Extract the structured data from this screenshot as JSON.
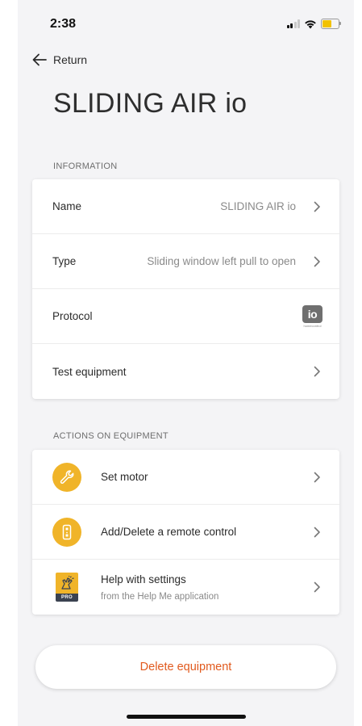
{
  "status_bar": {
    "time": "2:38"
  },
  "nav": {
    "return_label": "Return"
  },
  "page": {
    "title": "SLIDING AIR io"
  },
  "information": {
    "section_title": "INFORMATION",
    "rows": [
      {
        "label": "Name",
        "value": "SLIDING AIR io"
      },
      {
        "label": "Type",
        "value": "Sliding window left pull to open"
      },
      {
        "label": "Protocol",
        "value": "",
        "badge": "io",
        "badge_sub": "homecontrol"
      },
      {
        "label": "Test equipment",
        "value": ""
      }
    ]
  },
  "actions": {
    "section_title": "ACTIONS ON EQUIPMENT",
    "items": [
      {
        "label": "Set motor",
        "icon": "wrench-icon"
      },
      {
        "label": "Add/Delete a remote control",
        "icon": "remote-control-icon"
      },
      {
        "label": "Help with settings",
        "sublabel": "from the Help Me application",
        "icon": "help-me-pro-icon",
        "badge": "PRO"
      }
    ]
  },
  "footer": {
    "delete_label": "Delete equipment"
  },
  "colors": {
    "accent": "#f0b429",
    "danger": "#e15a1e",
    "background": "#f4f4f6"
  }
}
